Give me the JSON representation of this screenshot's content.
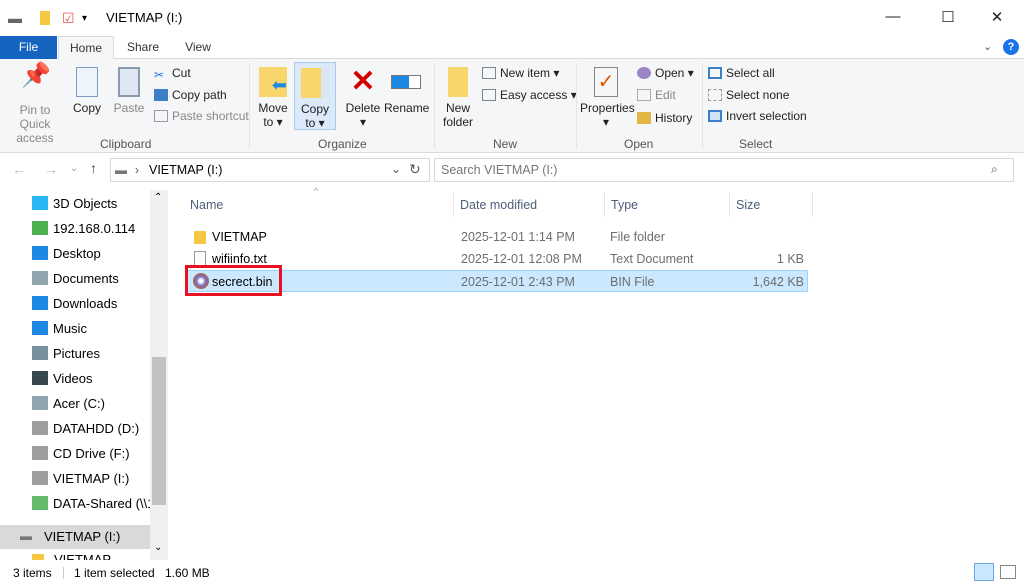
{
  "window": {
    "title": "VIETMAP (I:)",
    "minimize": "—",
    "maximize": "☐",
    "close": "✕"
  },
  "tabs": [
    {
      "label": "File"
    },
    {
      "label": "Home"
    },
    {
      "label": "Share"
    },
    {
      "label": "View"
    }
  ],
  "ribbon": {
    "clipboard": {
      "group": "Clipboard",
      "pin": "Pin to Quick access",
      "copy": "Copy",
      "paste": "Paste",
      "cut": "Cut",
      "copy_path": "Copy path",
      "paste_shortcut": "Paste shortcut"
    },
    "organize": {
      "group": "Organize",
      "move_to": "Move to",
      "copy_to": "Copy to",
      "delete": "Delete",
      "rename": "Rename"
    },
    "new": {
      "group": "New",
      "new_folder": "New folder",
      "new_item": "New item",
      "easy_access": "Easy access"
    },
    "open": {
      "group": "Open",
      "properties": "Properties",
      "open": "Open",
      "edit": "Edit",
      "history": "History"
    },
    "select": {
      "group": "Select",
      "select_all": "Select all",
      "select_none": "Select none",
      "invert": "Invert selection"
    }
  },
  "address": {
    "path": "VIETMAP (I:)",
    "search_placeholder": "Search VIETMAP (I:)"
  },
  "nav": [
    "3D Objects",
    "192.168.0.114",
    "Desktop",
    "Documents",
    "Downloads",
    "Music",
    "Pictures",
    "Videos",
    "Acer (C:)",
    "DATAHDD (D:)",
    "CD Drive (F:)",
    "VIETMAP (I:)",
    "DATA-Shared (\\\\1"
  ],
  "nav_selected": "VIETMAP (I:)",
  "nav_next": "VIETMAP",
  "columns": {
    "name": "Name",
    "date": "Date modified",
    "type": "Type",
    "size": "Size"
  },
  "files": [
    {
      "name": "VIETMAP",
      "date": "2025-12-01 1:14 PM",
      "type": "File folder",
      "size": ""
    },
    {
      "name": "wifiinfo.txt",
      "date": "2025-12-01 12:08 PM",
      "type": "Text Document",
      "size": "1 KB"
    },
    {
      "name": "secrect.bin",
      "date": "2025-12-01 2:43 PM",
      "type": "BIN File",
      "size": "1,642 KB"
    }
  ],
  "status": {
    "items": "3 items",
    "selected": "1 item selected",
    "size": "1.60 MB"
  },
  "colors": {
    "accent": "#1565c0",
    "selection": "#cce8ff",
    "highlight_box": "#e81123"
  }
}
